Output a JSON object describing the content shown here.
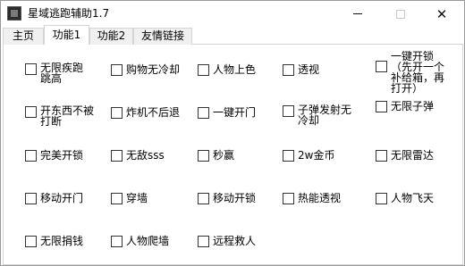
{
  "window": {
    "title": "星域逃跑辅助1.7",
    "min_icon": "minimize-icon",
    "max_icon": "maximize-icon",
    "close_icon": "close-icon",
    "close_glyph": "✕"
  },
  "tabs": [
    {
      "label": "主页",
      "active": false
    },
    {
      "label": "功能1",
      "active": true
    },
    {
      "label": "功能2",
      "active": false
    },
    {
      "label": "友情链接",
      "active": false
    }
  ],
  "options": [
    {
      "label": "无限疾跑跳高",
      "checked": false
    },
    {
      "label": "购物无冷却",
      "checked": false
    },
    {
      "label": "人物上色",
      "checked": false
    },
    {
      "label": "透视",
      "checked": false
    },
    {
      "label": "一键开锁（先开一个补给箱，再打开）",
      "checked": false
    },
    {
      "label": "开东西不被打断",
      "checked": false
    },
    {
      "label": "炸机不后退",
      "checked": false
    },
    {
      "label": "一键开门",
      "checked": false
    },
    {
      "label": "子弹发射无冷却",
      "checked": false
    },
    {
      "label": "无限子弹",
      "checked": false
    },
    {
      "label": "完美开锁",
      "checked": false
    },
    {
      "label": "无敌sss",
      "checked": false
    },
    {
      "label": "秒赢",
      "checked": false
    },
    {
      "label": "2w金币",
      "checked": false
    },
    {
      "label": "无限雷达",
      "checked": false
    },
    {
      "label": "移动开门",
      "checked": false
    },
    {
      "label": "穿墙",
      "checked": false
    },
    {
      "label": "移动开锁",
      "checked": false
    },
    {
      "label": "热能透视",
      "checked": false
    },
    {
      "label": "人物飞天",
      "checked": false
    },
    {
      "label": "无限捐钱",
      "checked": false
    },
    {
      "label": "人物爬墙",
      "checked": false
    },
    {
      "label": "远程救人",
      "checked": false
    }
  ]
}
